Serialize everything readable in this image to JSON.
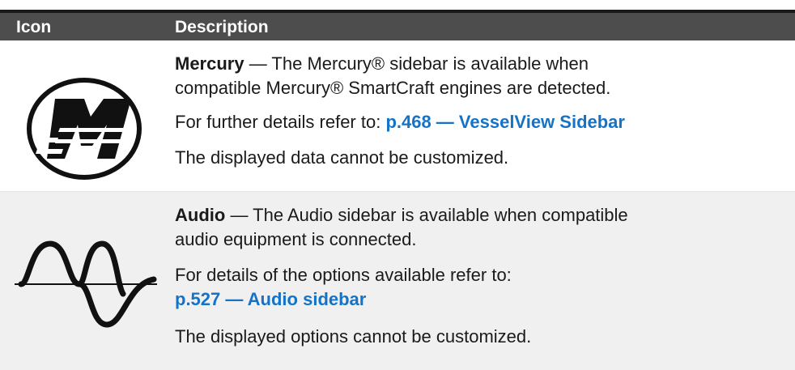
{
  "header": {
    "col_icon": "Icon",
    "col_description": "Description"
  },
  "rows": [
    {
      "icon": "mercury-logo-icon",
      "title": "Mercury",
      "desc_line": " — The Mercury® sidebar is available when compatible Mercury® SmartCraft engines are detected.",
      "ref_prefix": "For further details refer to: ",
      "ref_link": "p.468 — VesselView Sidebar",
      "note": "The displayed data cannot be customized."
    },
    {
      "icon": "audio-wave-icon",
      "title": "Audio",
      "desc_line": " — The Audio sidebar is available when compatible audio equipment is connected.",
      "ref_prefix": "For details of the options available refer to:",
      "ref_link": "p.527 — Audio sidebar",
      "note": "The displayed options cannot be customized."
    }
  ],
  "colors": {
    "header_bg": "#4d4d4d",
    "link": "#1473c7",
    "row_alt_bg": "#f0f0f0"
  }
}
